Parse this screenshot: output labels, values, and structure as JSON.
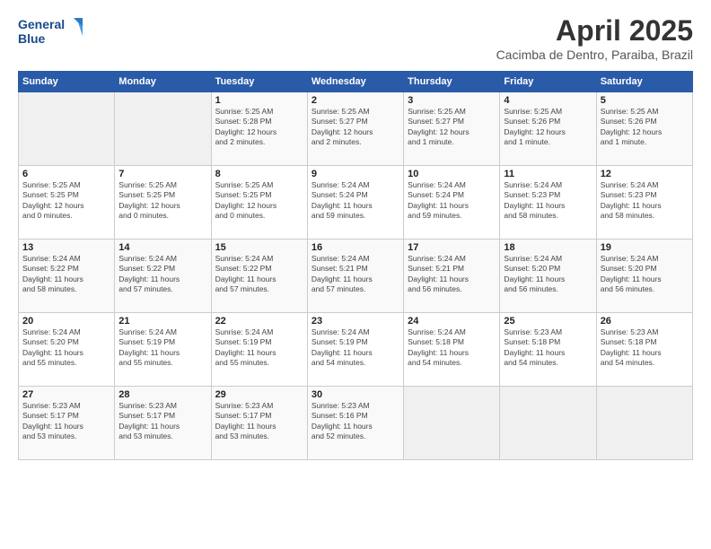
{
  "header": {
    "logo_line1": "General",
    "logo_line2": "Blue",
    "month_title": "April 2025",
    "subtitle": "Cacimba de Dentro, Paraiba, Brazil"
  },
  "weekdays": [
    "Sunday",
    "Monday",
    "Tuesday",
    "Wednesday",
    "Thursday",
    "Friday",
    "Saturday"
  ],
  "weeks": [
    [
      {
        "day": "",
        "info": ""
      },
      {
        "day": "",
        "info": ""
      },
      {
        "day": "1",
        "info": "Sunrise: 5:25 AM\nSunset: 5:28 PM\nDaylight: 12 hours\nand 2 minutes."
      },
      {
        "day": "2",
        "info": "Sunrise: 5:25 AM\nSunset: 5:27 PM\nDaylight: 12 hours\nand 2 minutes."
      },
      {
        "day": "3",
        "info": "Sunrise: 5:25 AM\nSunset: 5:27 PM\nDaylight: 12 hours\nand 1 minute."
      },
      {
        "day": "4",
        "info": "Sunrise: 5:25 AM\nSunset: 5:26 PM\nDaylight: 12 hours\nand 1 minute."
      },
      {
        "day": "5",
        "info": "Sunrise: 5:25 AM\nSunset: 5:26 PM\nDaylight: 12 hours\nand 1 minute."
      }
    ],
    [
      {
        "day": "6",
        "info": "Sunrise: 5:25 AM\nSunset: 5:25 PM\nDaylight: 12 hours\nand 0 minutes."
      },
      {
        "day": "7",
        "info": "Sunrise: 5:25 AM\nSunset: 5:25 PM\nDaylight: 12 hours\nand 0 minutes."
      },
      {
        "day": "8",
        "info": "Sunrise: 5:25 AM\nSunset: 5:25 PM\nDaylight: 12 hours\nand 0 minutes."
      },
      {
        "day": "9",
        "info": "Sunrise: 5:24 AM\nSunset: 5:24 PM\nDaylight: 11 hours\nand 59 minutes."
      },
      {
        "day": "10",
        "info": "Sunrise: 5:24 AM\nSunset: 5:24 PM\nDaylight: 11 hours\nand 59 minutes."
      },
      {
        "day": "11",
        "info": "Sunrise: 5:24 AM\nSunset: 5:23 PM\nDaylight: 11 hours\nand 58 minutes."
      },
      {
        "day": "12",
        "info": "Sunrise: 5:24 AM\nSunset: 5:23 PM\nDaylight: 11 hours\nand 58 minutes."
      }
    ],
    [
      {
        "day": "13",
        "info": "Sunrise: 5:24 AM\nSunset: 5:22 PM\nDaylight: 11 hours\nand 58 minutes."
      },
      {
        "day": "14",
        "info": "Sunrise: 5:24 AM\nSunset: 5:22 PM\nDaylight: 11 hours\nand 57 minutes."
      },
      {
        "day": "15",
        "info": "Sunrise: 5:24 AM\nSunset: 5:22 PM\nDaylight: 11 hours\nand 57 minutes."
      },
      {
        "day": "16",
        "info": "Sunrise: 5:24 AM\nSunset: 5:21 PM\nDaylight: 11 hours\nand 57 minutes."
      },
      {
        "day": "17",
        "info": "Sunrise: 5:24 AM\nSunset: 5:21 PM\nDaylight: 11 hours\nand 56 minutes."
      },
      {
        "day": "18",
        "info": "Sunrise: 5:24 AM\nSunset: 5:20 PM\nDaylight: 11 hours\nand 56 minutes."
      },
      {
        "day": "19",
        "info": "Sunrise: 5:24 AM\nSunset: 5:20 PM\nDaylight: 11 hours\nand 56 minutes."
      }
    ],
    [
      {
        "day": "20",
        "info": "Sunrise: 5:24 AM\nSunset: 5:20 PM\nDaylight: 11 hours\nand 55 minutes."
      },
      {
        "day": "21",
        "info": "Sunrise: 5:24 AM\nSunset: 5:19 PM\nDaylight: 11 hours\nand 55 minutes."
      },
      {
        "day": "22",
        "info": "Sunrise: 5:24 AM\nSunset: 5:19 PM\nDaylight: 11 hours\nand 55 minutes."
      },
      {
        "day": "23",
        "info": "Sunrise: 5:24 AM\nSunset: 5:19 PM\nDaylight: 11 hours\nand 54 minutes."
      },
      {
        "day": "24",
        "info": "Sunrise: 5:24 AM\nSunset: 5:18 PM\nDaylight: 11 hours\nand 54 minutes."
      },
      {
        "day": "25",
        "info": "Sunrise: 5:23 AM\nSunset: 5:18 PM\nDaylight: 11 hours\nand 54 minutes."
      },
      {
        "day": "26",
        "info": "Sunrise: 5:23 AM\nSunset: 5:18 PM\nDaylight: 11 hours\nand 54 minutes."
      }
    ],
    [
      {
        "day": "27",
        "info": "Sunrise: 5:23 AM\nSunset: 5:17 PM\nDaylight: 11 hours\nand 53 minutes."
      },
      {
        "day": "28",
        "info": "Sunrise: 5:23 AM\nSunset: 5:17 PM\nDaylight: 11 hours\nand 53 minutes."
      },
      {
        "day": "29",
        "info": "Sunrise: 5:23 AM\nSunset: 5:17 PM\nDaylight: 11 hours\nand 53 minutes."
      },
      {
        "day": "30",
        "info": "Sunrise: 5:23 AM\nSunset: 5:16 PM\nDaylight: 11 hours\nand 52 minutes."
      },
      {
        "day": "",
        "info": ""
      },
      {
        "day": "",
        "info": ""
      },
      {
        "day": "",
        "info": ""
      }
    ]
  ]
}
